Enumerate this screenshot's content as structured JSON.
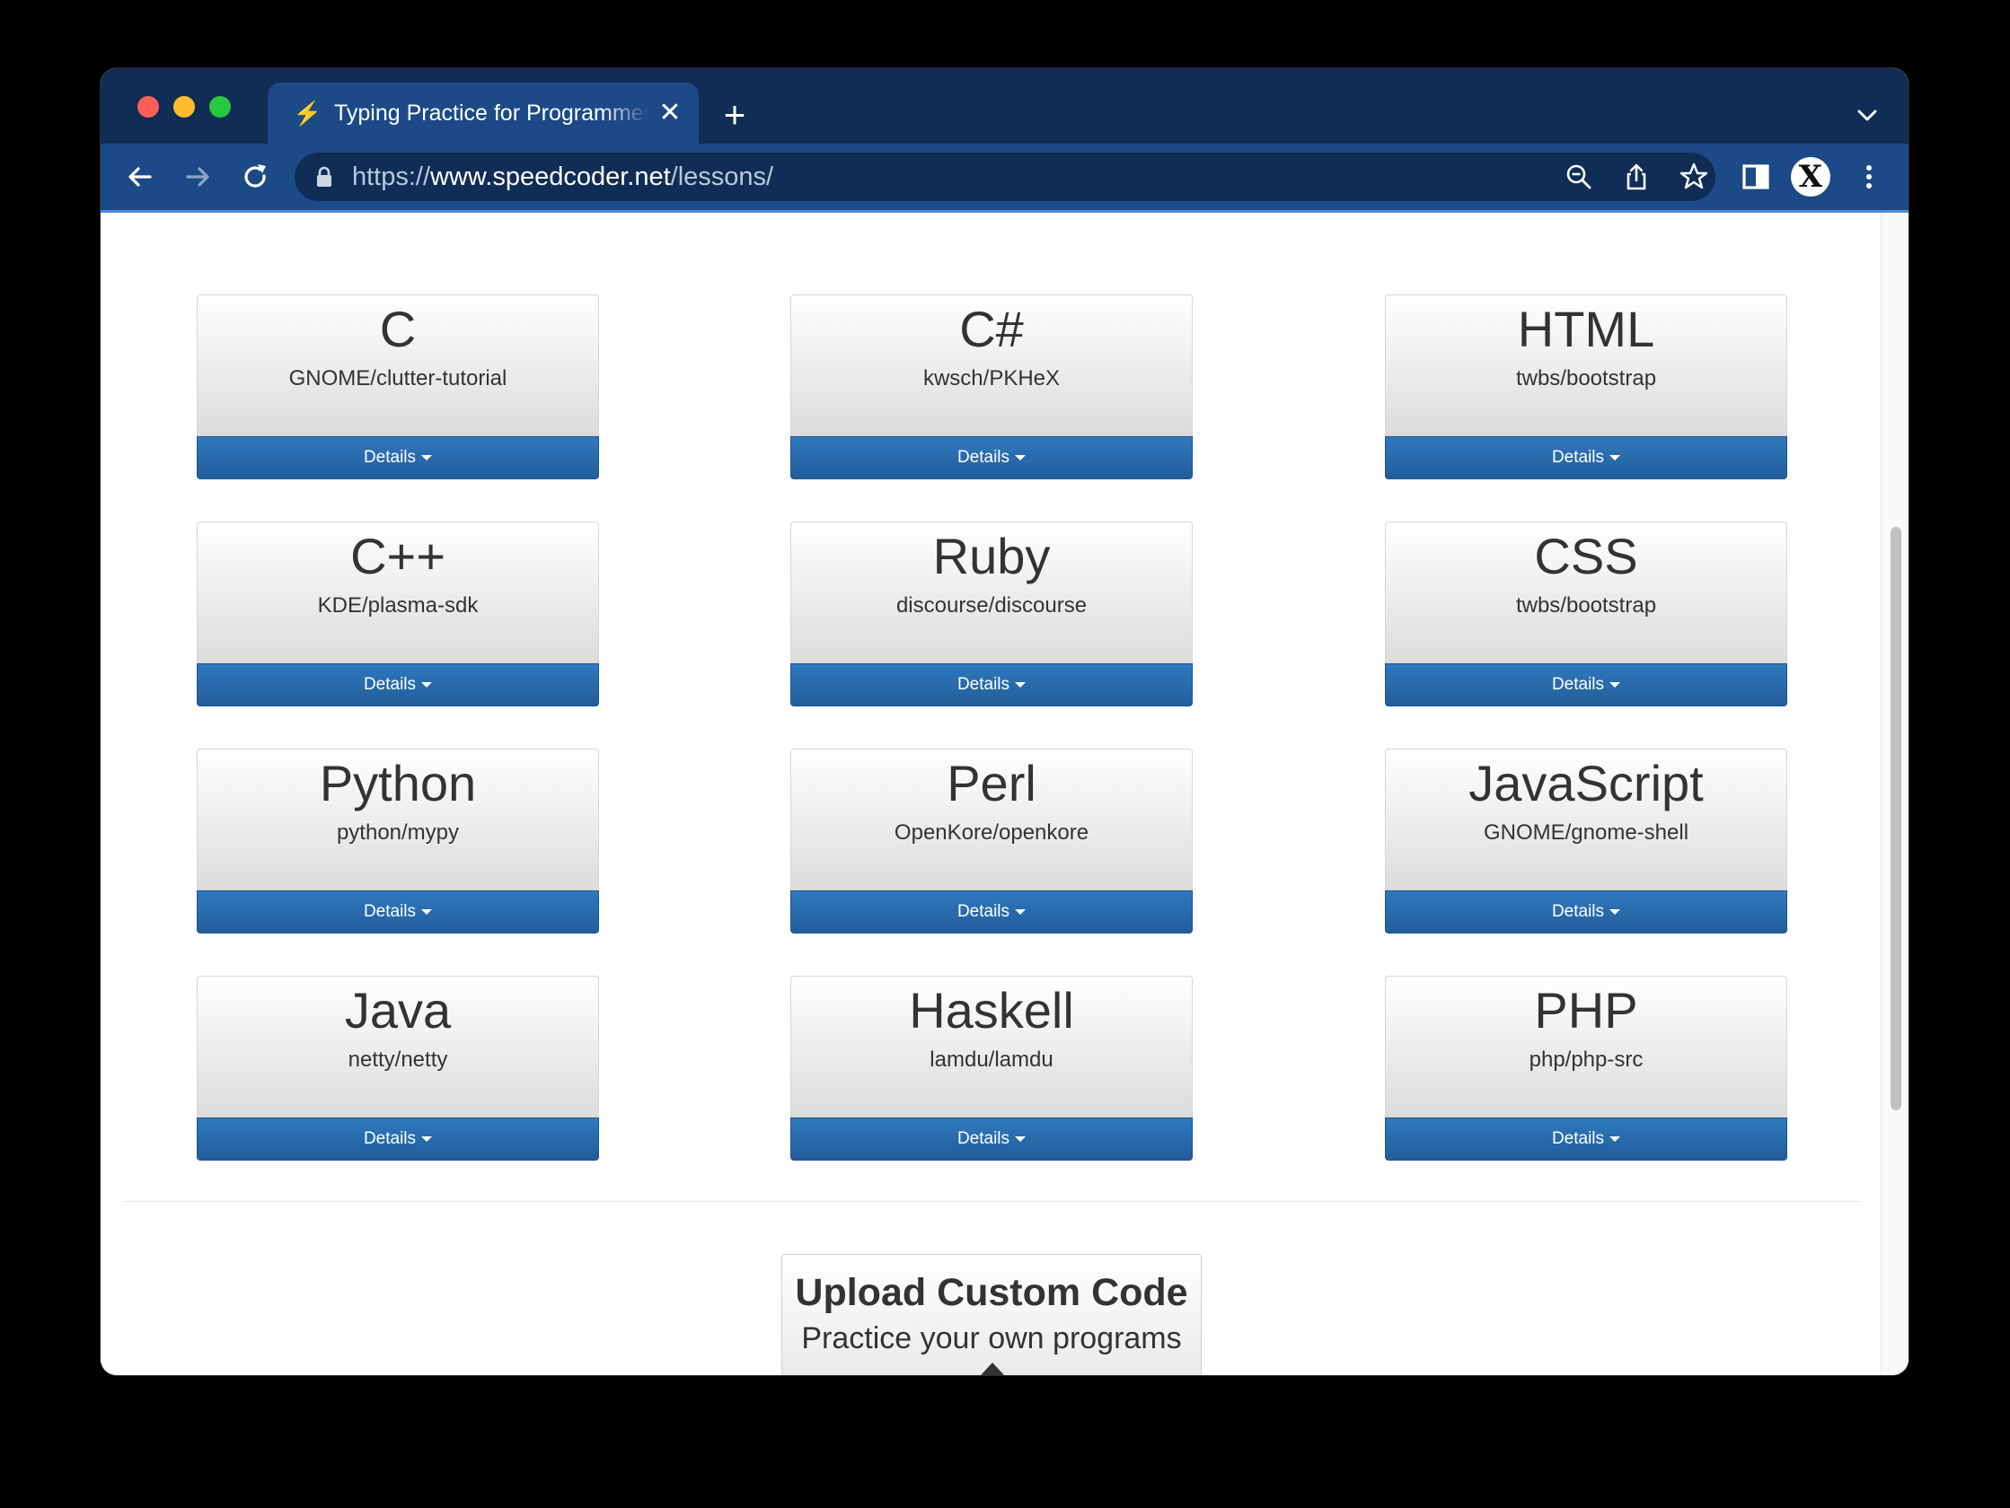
{
  "browser": {
    "tab_title": "Typing Practice for Programmers",
    "tab_favicon": "lightning-icon",
    "url_scheme": "https://",
    "url_host": "www.speedcoder.net",
    "url_path": "/lessons/",
    "profile_initial": "X"
  },
  "lessons": [
    {
      "language": "C",
      "repo": "GNOME/clutter-tutorial",
      "button": "Details"
    },
    {
      "language": "C#",
      "repo": "kwsch/PKHeX",
      "button": "Details"
    },
    {
      "language": "HTML",
      "repo": "twbs/bootstrap",
      "button": "Details"
    },
    {
      "language": "C++",
      "repo": "KDE/plasma-sdk",
      "button": "Details"
    },
    {
      "language": "Ruby",
      "repo": "discourse/discourse",
      "button": "Details"
    },
    {
      "language": "CSS",
      "repo": "twbs/bootstrap",
      "button": "Details"
    },
    {
      "language": "Python",
      "repo": "python/mypy",
      "button": "Details"
    },
    {
      "language": "Perl",
      "repo": "OpenKore/openkore",
      "button": "Details"
    },
    {
      "language": "JavaScript",
      "repo": "GNOME/gnome-shell",
      "button": "Details"
    },
    {
      "language": "Java",
      "repo": "netty/netty",
      "button": "Details"
    },
    {
      "language": "Haskell",
      "repo": "lamdu/lamdu",
      "button": "Details"
    },
    {
      "language": "PHP",
      "repo": "php/php-src",
      "button": "Details"
    }
  ],
  "upload": {
    "title": "Upload Custom Code",
    "subtitle": "Practice your own programs",
    "icon": "upload-icon"
  },
  "colors": {
    "tab_strip": "#0f2d55",
    "toolbar": "#1b4a86",
    "details_button": "#2a6cad"
  }
}
